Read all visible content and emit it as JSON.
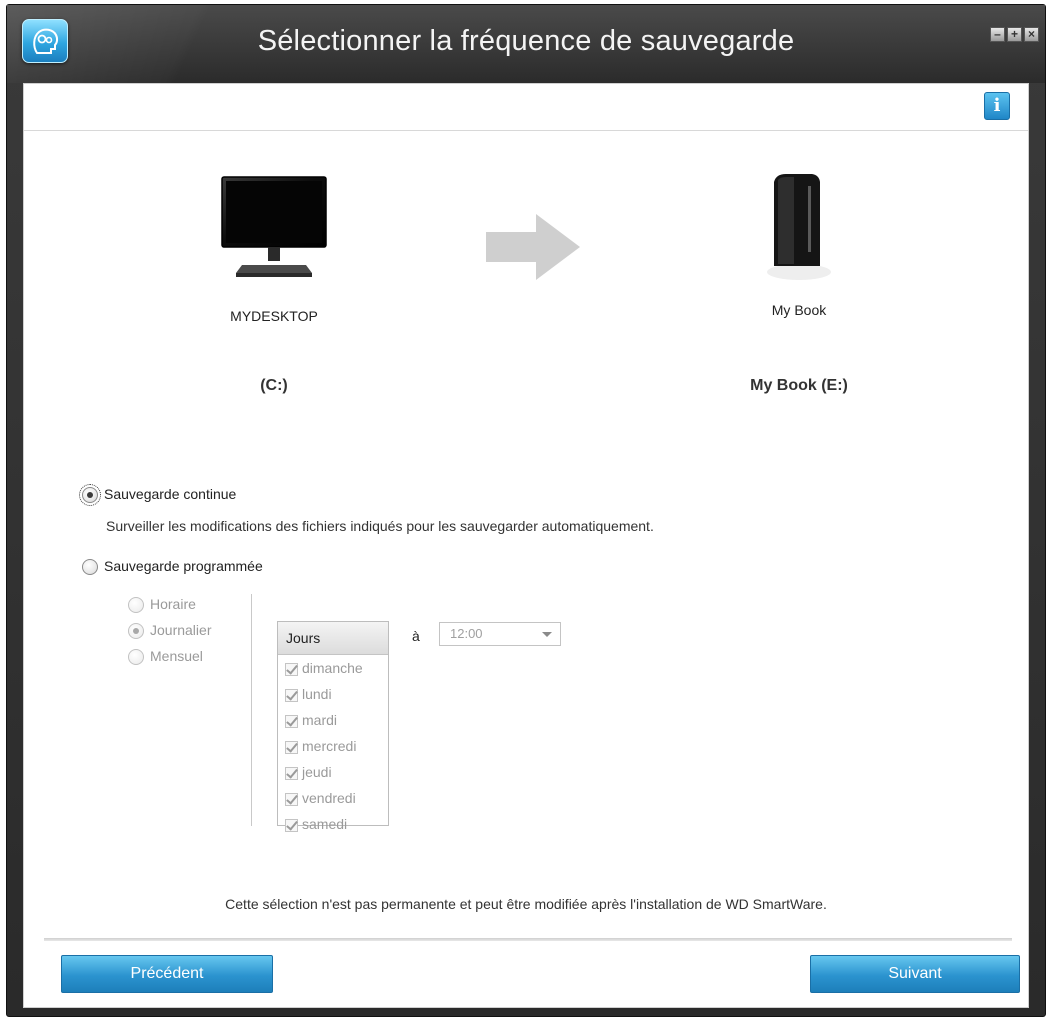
{
  "window": {
    "title": "Sélectionner la fréquence de sauvegarde",
    "controls": {
      "minimize": "–",
      "maximize": "+",
      "close": "×"
    }
  },
  "source": {
    "computer_name": "MYDESKTOP",
    "drive": "(C:)"
  },
  "destination": {
    "device_name": "My Book",
    "drive": "My Book (E:)"
  },
  "options": {
    "continuous": {
      "label": "Sauvegarde continue",
      "description": "Surveiller les modifications des fichiers indiqués pour les sauvegarder automatiquement.",
      "selected": true
    },
    "scheduled": {
      "label": "Sauvegarde programmée",
      "selected": false,
      "frequency": [
        {
          "label": "Horaire",
          "selected": false
        },
        {
          "label": "Journalier",
          "selected": true
        },
        {
          "label": "Mensuel",
          "selected": false
        }
      ],
      "days_header": "Jours",
      "days": [
        "dimanche",
        "lundi",
        "mardi",
        "mercredi",
        "jeudi",
        "vendredi",
        "samedi"
      ],
      "time_prefix": "à",
      "time_value": "12:00"
    }
  },
  "note": "Cette sélection n'est pas permanente et peut être modifiée après l'installation de WD SmartWare.",
  "buttons": {
    "previous": "Précédent",
    "next": "Suivant"
  },
  "colors": {
    "button_blue": "#2b93cf",
    "title_bar": "#2b2b2b"
  }
}
